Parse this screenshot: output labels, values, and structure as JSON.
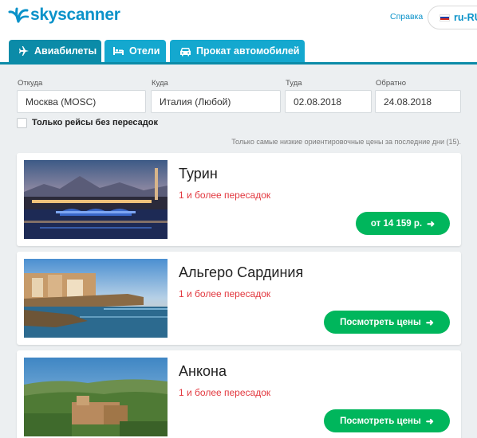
{
  "header": {
    "logo_text": "skyscanner",
    "help_link": "Справка",
    "language": "ru-RU",
    "brand_color": "#0a92c9"
  },
  "tabs": [
    {
      "label": "Авиабилеты",
      "icon": "airplane-icon",
      "active": true
    },
    {
      "label": "Отели",
      "icon": "bed-icon",
      "active": false
    },
    {
      "label": "Прокат автомобилей",
      "icon": "car-icon",
      "active": false
    }
  ],
  "search": {
    "from": {
      "label": "Откуда",
      "value": "Москва (MOSC)"
    },
    "to": {
      "label": "Куда",
      "value": "Италия (Любой)"
    },
    "depart": {
      "label": "Туда",
      "value": "02.08.2018"
    },
    "return": {
      "label": "Обратно",
      "value": "24.08.2018"
    },
    "direct_only": {
      "label": "Только рейсы без пересадок",
      "checked": false
    }
  },
  "price_note": "Только самые низкие ориентировочные цены за последние дни (15).",
  "destinations": [
    {
      "title": "Турин",
      "stops": "1 и более пересадок",
      "button": "от 14 159 р.",
      "image": "turin-river-bridge-night"
    },
    {
      "title": "Альгеро Сардиния",
      "stops": "1 и более пересадок",
      "button": "Посмотреть цены",
      "image": "alghero-seafront-dusk"
    },
    {
      "title": "Анкона",
      "stops": "1 и более пересадок",
      "button": "Посмотреть цены",
      "image": "ancona-hills-landscape"
    }
  ],
  "colors": {
    "tab_active": "#0b8ba8",
    "tab_inactive": "#14a8cf",
    "button_green": "#00b65c",
    "stops_red": "#e2383f"
  }
}
